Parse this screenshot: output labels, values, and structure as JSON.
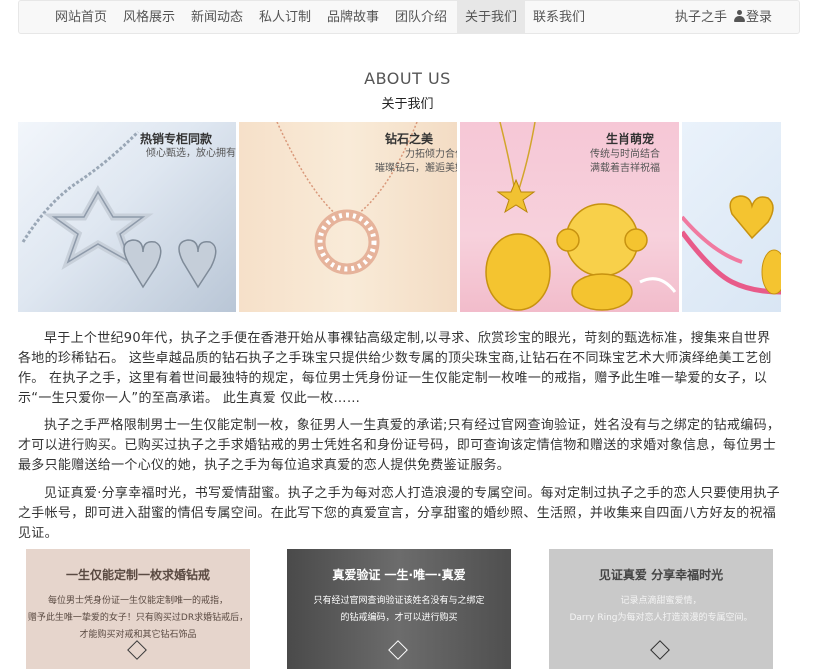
{
  "nav": {
    "items": [
      "网站首页",
      "风格展示",
      "新闻动态",
      "私人订制",
      "品牌故事",
      "团队介绍",
      "关于我们",
      "联系我们"
    ],
    "active": "关于我们",
    "user_name": "执子之手",
    "login_label": "登录"
  },
  "section": {
    "title_en": "ABOUT US",
    "title_cn": "关于我们"
  },
  "banners": [
    {
      "title": "热销专柜同款",
      "subtitle": "倾心甄选，放心拥有"
    },
    {
      "title": "钻石之美",
      "subtitle": "力拓倾力合作\n璀璨钻石，邂逅美好"
    },
    {
      "title": "生肖萌宠",
      "subtitle": "传统与时尚结合\n满载着吉祥祝福"
    },
    {
      "title": "",
      "subtitle": ""
    }
  ],
  "paragraphs": [
    "早于上个世纪90年代，执子之手便在香港开始从事裸钻高级定制,以寻求、欣赏珍宝的眼光，苛刻的甄选标准，搜集来自世界各地的珍稀钻石。 这些卓越品质的钻石执子之手珠宝只提供给少数专属的顶尖珠宝商,让钻石在不同珠宝艺术大师演绎绝美工艺创作。 在执子之手，这里有着世间最独特的规定，每位男士凭身份证一生仅能定制一枚唯一的戒指，赠予此生唯一挚爱的女子，以示“一生只爱你一人”的至高承诺。 此生真爱 仅此一枚……",
    "执子之手严格限制男士一生仅能定制一枚，象征男人一生真爱的承诺;只有经过官网查询验证，姓名没有与之绑定的钻戒编码，才可以进行购买。已购买过执子之手求婚钻戒的男士凭姓名和身份证号码，即可查询该定情信物和赠送的求婚对象信息，每位男士最多只能赠送给一个心仪的她，执子之手为每位追求真爱的恋人提供免费鉴证服务。",
    "见证真爱·分享幸福时光，书写爱情甜蜜。执子之手为每对恋人打造浪漫的专属空间。每对定制过执子之手的恋人只要使用执子之手帐号，即可进入甜蜜的情侣专属空间。在此写下您的真爱宣言，分享甜蜜的婚纱照、生活照，并收集来自四面八方好友的祝福见证。"
  ],
  "cards": [
    {
      "title": "一生仅能定制一枚求婚钻戒",
      "text": "每位男士凭身份证一生仅能定制唯一的戒指，\n赠予此生唯一挚爱的女子！只有购买过DR求婚钻戒后，\n才能购买对戒和其它钻石饰品"
    },
    {
      "title": "真爱验证 一生·唯一·真爱",
      "text": "只有经过官网查询验证该姓名没有与之绑定\n的钻戒编码，才可以进行购买"
    },
    {
      "title": "见证真爱 分享幸福时光",
      "text": "记录点滴甜蜜爱情，\nDarry Ring为每对恋人打造浪漫的专属空间。"
    }
  ]
}
